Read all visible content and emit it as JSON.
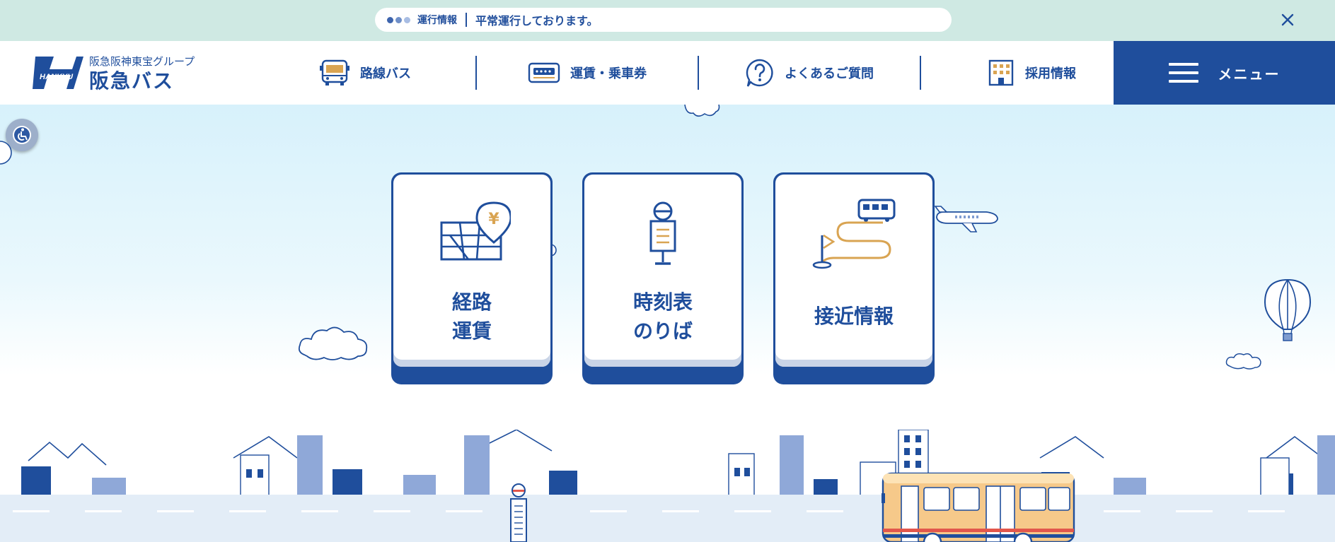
{
  "notice": {
    "tag": "運行情報",
    "text": "平常運行しております。",
    "dot_colors": [
      "#3d64ad",
      "#6f8fc8",
      "#a8bde3"
    ]
  },
  "logo": {
    "group": "阪急阪神東宝グループ",
    "name": "阪急バス",
    "emblem_text": "HANKYU"
  },
  "nav": {
    "items": [
      {
        "label": "路線バス",
        "icon": "bus-icon"
      },
      {
        "label": "運賃・乗車券",
        "icon": "ticket-icon"
      },
      {
        "label": "よくあるご質問",
        "icon": "question-icon"
      },
      {
        "label": "採用情報",
        "icon": "building-icon"
      }
    ],
    "menu_label": "メニュー"
  },
  "cards": [
    {
      "line1": "経路",
      "line2": "運賃",
      "icon": "map-fare-icon"
    },
    {
      "line1": "時刻表",
      "line2": "のりば",
      "icon": "bus-stop-icon"
    },
    {
      "line1": "接近情報",
      "icon": "bus-route-icon"
    }
  ],
  "colors": {
    "brand": "#1f4e9c",
    "notice_bg": "#cfe9e3",
    "accent": "#d9a452"
  }
}
